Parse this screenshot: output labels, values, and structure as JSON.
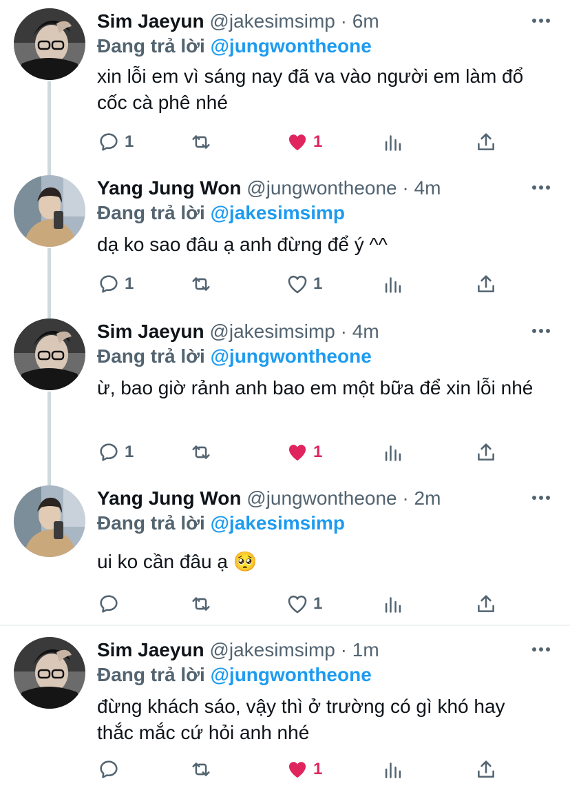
{
  "tweets": [
    {
      "name": "Sim Jaeyun",
      "handle": "@jakesimsimp",
      "dot": "·",
      "time": "6m",
      "replying_prefix": "Đang trả lời",
      "replying_to": "@jungwontheone",
      "text": "xin lỗi em vì sáng nay đã va vào người em làm đổ cốc cà phê nhé",
      "reply_count": "1",
      "retweet_count": "",
      "like_count": "1",
      "liked": true,
      "avatar": "avatar-jaeyun"
    },
    {
      "name": "Yang Jung Won",
      "handle": "@jungwontheone",
      "dot": "·",
      "time": "4m",
      "replying_prefix": "Đang trả lời",
      "replying_to": "@jakesimsimp",
      "text": "dạ ko sao đâu ạ anh đừng để ý ^^",
      "reply_count": "1",
      "retweet_count": "",
      "like_count": "1",
      "liked": false,
      "avatar": "avatar-jungwon"
    },
    {
      "name": "Sim Jaeyun",
      "handle": "@jakesimsimp",
      "dot": "·",
      "time": "4m",
      "replying_prefix": "Đang trả lời",
      "replying_to": "@jungwontheone",
      "text": "ừ, bao giờ rảnh anh bao em một bữa để xin lỗi nhé",
      "reply_count": "1",
      "retweet_count": "",
      "like_count": "1",
      "liked": true,
      "avatar": "avatar-jaeyun"
    },
    {
      "name": "Yang Jung Won",
      "handle": "@jungwontheone",
      "dot": "·",
      "time": "2m",
      "replying_prefix": "Đang trả lời",
      "replying_to": "@jakesimsimp",
      "text": "ui ko cần đâu ạ 🥺",
      "reply_count": "",
      "retweet_count": "",
      "like_count": "1",
      "liked": false,
      "avatar": "avatar-jungwon"
    },
    {
      "name": "Sim Jaeyun",
      "handle": "@jakesimsimp",
      "dot": "·",
      "time": "1m",
      "replying_prefix": "Đang trả lời",
      "replying_to": "@jungwontheone",
      "text": "đừng khách sáo, vậy thì ở trường có gì khó hay thắc mắc cứ hỏi anh nhé",
      "reply_count": "",
      "retweet_count": "",
      "like_count": "1",
      "liked": true,
      "avatar": "avatar-jaeyun"
    }
  ],
  "icons": {
    "reply": "reply-icon",
    "retweet": "retweet-icon",
    "like": "heart-icon",
    "analytics": "analytics-icon",
    "share": "share-icon",
    "more": "more-icon"
  },
  "colors": {
    "accent": "#1d9bf0",
    "like": "#e0245e",
    "muted": "#536471",
    "text": "#0f1419",
    "thread": "#cfd9de"
  }
}
